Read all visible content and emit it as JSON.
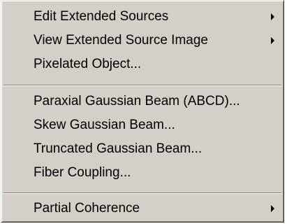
{
  "menu": {
    "group1": [
      {
        "label": "Edit Extended Sources",
        "submenu": true
      },
      {
        "label": "View Extended Source Image",
        "submenu": true
      },
      {
        "label": "Pixelated Object...",
        "submenu": false
      }
    ],
    "group2": [
      {
        "label": "Paraxial Gaussian Beam (ABCD)...",
        "submenu": false
      },
      {
        "label": "Skew Gaussian Beam...",
        "submenu": false
      },
      {
        "label": "Truncated Gaussian Beam...",
        "submenu": false
      },
      {
        "label": "Fiber Coupling...",
        "submenu": false
      }
    ],
    "group3": [
      {
        "label": "Partial Coherence",
        "submenu": true
      }
    ]
  },
  "icons": {
    "submenu_arrow": "submenu-arrow-icon"
  }
}
